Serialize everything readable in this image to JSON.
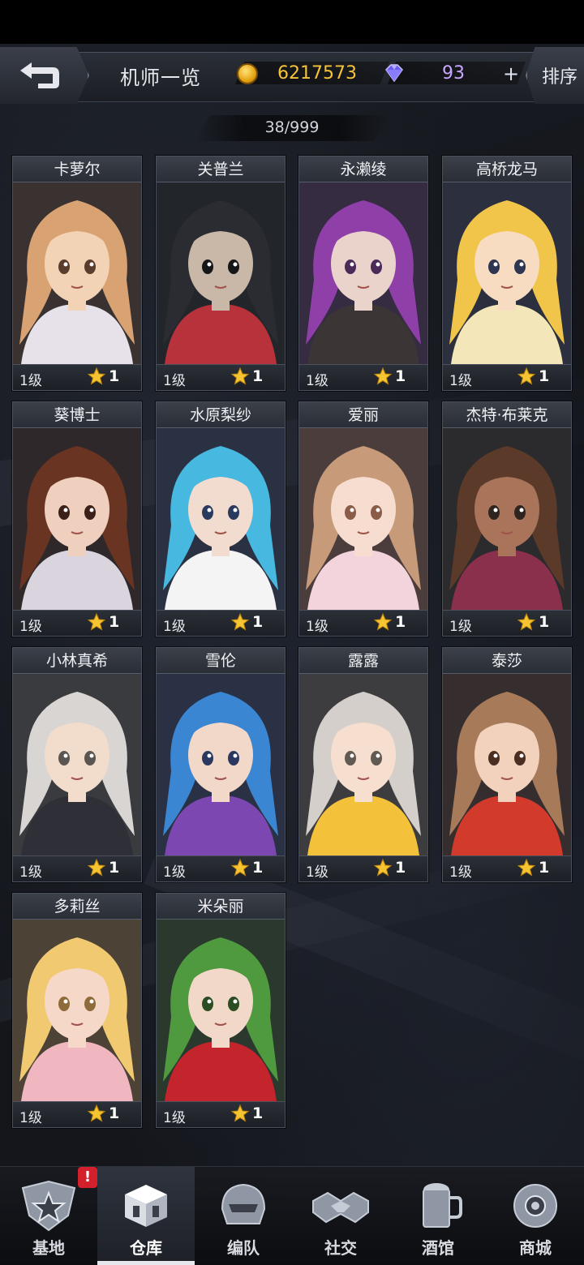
{
  "header": {
    "title": "机师一览",
    "coins": "6217573",
    "gems": "93",
    "plus_label": "+",
    "sort_label": "排序"
  },
  "roster": {
    "count": "38/999"
  },
  "pilots": [
    {
      "name": "卡萝尔",
      "level": "1级",
      "stars": "1"
    },
    {
      "name": "关普兰",
      "level": "1级",
      "stars": "1"
    },
    {
      "name": "永濑绫",
      "level": "1级",
      "stars": "1"
    },
    {
      "name": "高桥龙马",
      "level": "1级",
      "stars": "1"
    },
    {
      "name": "葵博士",
      "level": "1级",
      "stars": "1"
    },
    {
      "name": "水原梨纱",
      "level": "1级",
      "stars": "1"
    },
    {
      "name": "爱丽",
      "level": "1级",
      "stars": "1"
    },
    {
      "name": "杰特·布莱克",
      "level": "1级",
      "stars": "1"
    },
    {
      "name": "小林真希",
      "level": "1级",
      "stars": "1"
    },
    {
      "name": "雪伦",
      "level": "1级",
      "stars": "1"
    },
    {
      "name": "露露",
      "level": "1级",
      "stars": "1"
    },
    {
      "name": "泰莎",
      "level": "1级",
      "stars": "1"
    },
    {
      "name": "多莉丝",
      "level": "1级",
      "stars": "1"
    },
    {
      "name": "米朵丽",
      "level": "1级",
      "stars": "1"
    }
  ],
  "nav": {
    "items": [
      {
        "label": "基地",
        "icon": "base-star-icon",
        "alert": "!"
      },
      {
        "label": "仓库",
        "icon": "warehouse-crate-icon"
      },
      {
        "label": "编队",
        "icon": "team-helmet-icon"
      },
      {
        "label": "社交",
        "icon": "handshake-icon"
      },
      {
        "label": "酒馆",
        "icon": "tavern-beer-icon"
      },
      {
        "label": "商城",
        "icon": "shop-robot-icon"
      }
    ],
    "active": "仓库"
  },
  "colors": {
    "coin": "#f5c23a",
    "gem": "#c9a6ff",
    "alert": "#d3202a"
  }
}
